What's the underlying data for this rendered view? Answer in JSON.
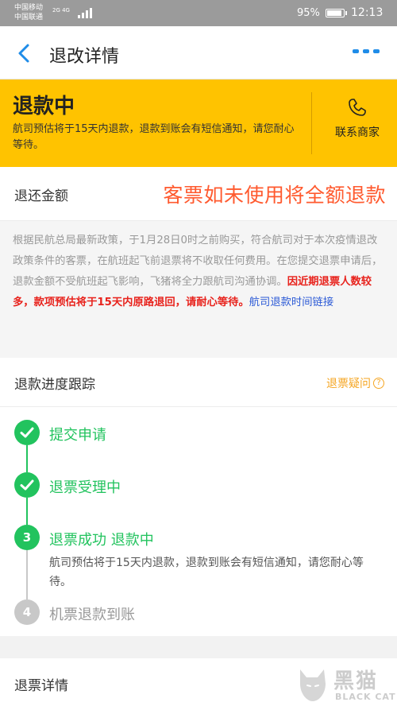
{
  "status_bar": {
    "carrier_1": "中国移动",
    "carrier_2": "中国联通",
    "network": "2G 4G",
    "battery": "95%",
    "battery_level": 0.95,
    "time": "12:13"
  },
  "nav": {
    "back_icon": "chevron-left-icon",
    "title": "退改详情",
    "more_icon": "ellipsis-icon"
  },
  "banner": {
    "status": "退款中",
    "description": "航司预估将于15天内退款，退款到账会有短信通知，请您耐心等待。",
    "contact_label": "联系商家",
    "contact_icon": "phone-icon"
  },
  "refund": {
    "label": "退还金额",
    "note": "客票如未使用将全额退款"
  },
  "policy": {
    "text": "根据民航总局最新政策，于1月28日0时之前购买，符合航司对于本次疫情退改政策条件的客票，在航班起飞前退票将不收取任何费用。在您提交退票申请后，退款金额不受航班起飞影响，飞猪将全力跟航司沟通协调。",
    "highlight": "因近期退票人数较多，款项预估将于15天内原路退回，请耐心等待。",
    "link": "航司退款时间链接"
  },
  "tracking": {
    "title": "退款进度跟踪",
    "faq_label": "退票疑问",
    "steps": [
      {
        "label": "提交申请",
        "state": "done"
      },
      {
        "label": "退票受理中",
        "state": "done"
      },
      {
        "number": "3",
        "label": "退票成功 退款中",
        "state": "current",
        "sub": "航司预估将于15天内退款，退款到账会有短信通知，请您耐心等待。"
      },
      {
        "number": "4",
        "label": "机票退款到账",
        "state": "pending"
      }
    ]
  },
  "detail": {
    "title": "退票详情"
  },
  "watermark": {
    "cn": "黑猫",
    "en": "BLACK CAT"
  },
  "colors": {
    "accent_blue": "#1f8ce8",
    "banner_yellow": "#ffc300",
    "success_green": "#22c35e",
    "alert_red": "#e8231d",
    "note_orange": "#ff5a2f",
    "faq_orange": "#f5a623"
  }
}
